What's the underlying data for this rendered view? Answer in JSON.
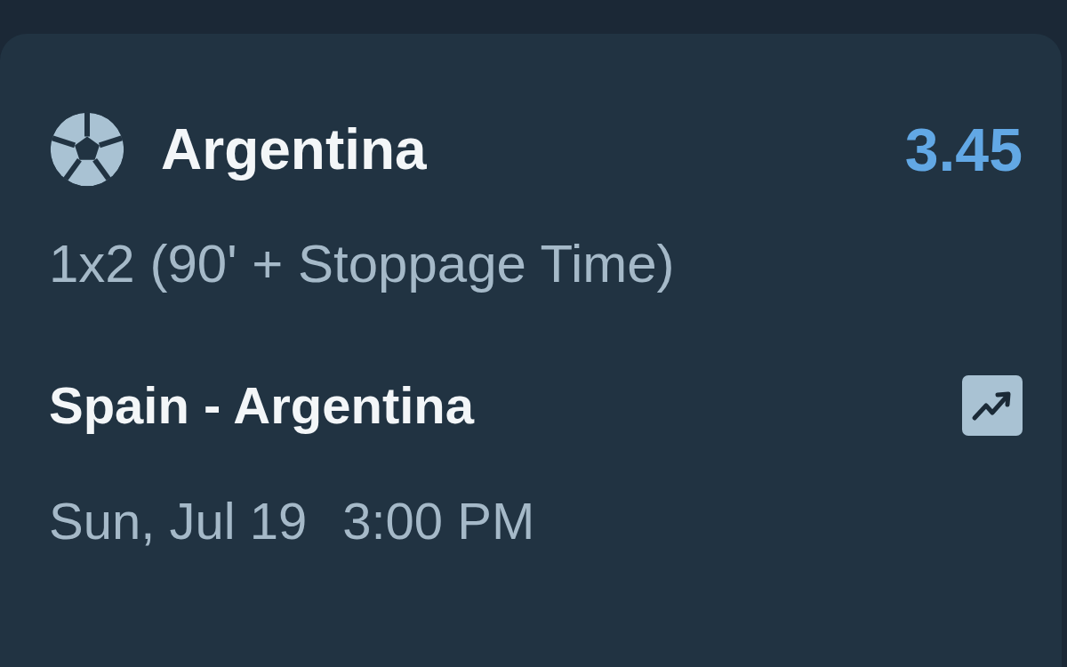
{
  "selection": {
    "team": "Argentina",
    "odds": "3.45",
    "market": "1x2 (90' + Stoppage Time)"
  },
  "event": {
    "name": "Spain - Argentina",
    "date": "Sun, Jul 19",
    "time": "3:00 PM"
  }
}
